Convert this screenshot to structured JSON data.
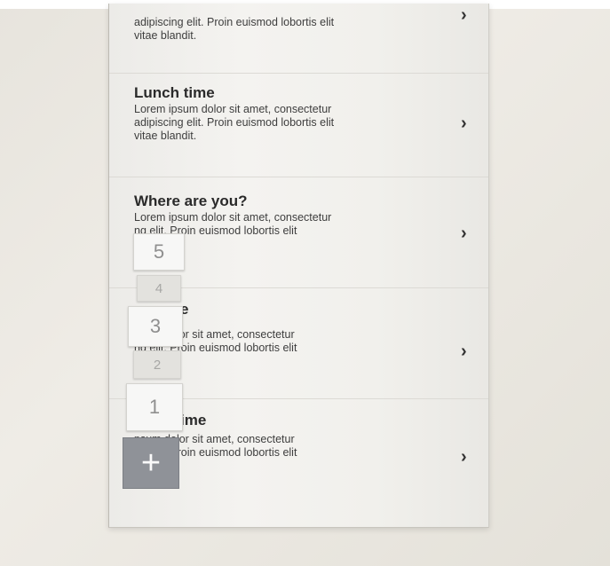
{
  "list": {
    "items": [
      {
        "title": "",
        "body": "adipiscing elit. Proin euismod lobortis elit\nvitae blandit."
      },
      {
        "title": "Lunch time",
        "body": "Lorem ipsum dolor sit amet, consectetur\nadipiscing elit. Proin euismod lobortis elit\nvitae blandit."
      },
      {
        "title": "Where are you?",
        "body": "Lorem ipsum dolor sit amet, consectetur\n          ng elit. Proin euismod lobortis elit\n          andit."
      },
      {
        "title": "e",
        "body": "          psum dolor sit amet, consectetur\n          ng elit. Proin euismod lobortis elit\n          andit."
      },
      {
        "title": "ime",
        "body": "          psum dolor sit amet, consectetur\n          ng elit. Proin euismod lobortis elit\n          andit."
      }
    ],
    "chevron": "›"
  },
  "picker": {
    "options": [
      "5",
      "4",
      "3",
      "2",
      "1"
    ],
    "add_label": "+"
  }
}
